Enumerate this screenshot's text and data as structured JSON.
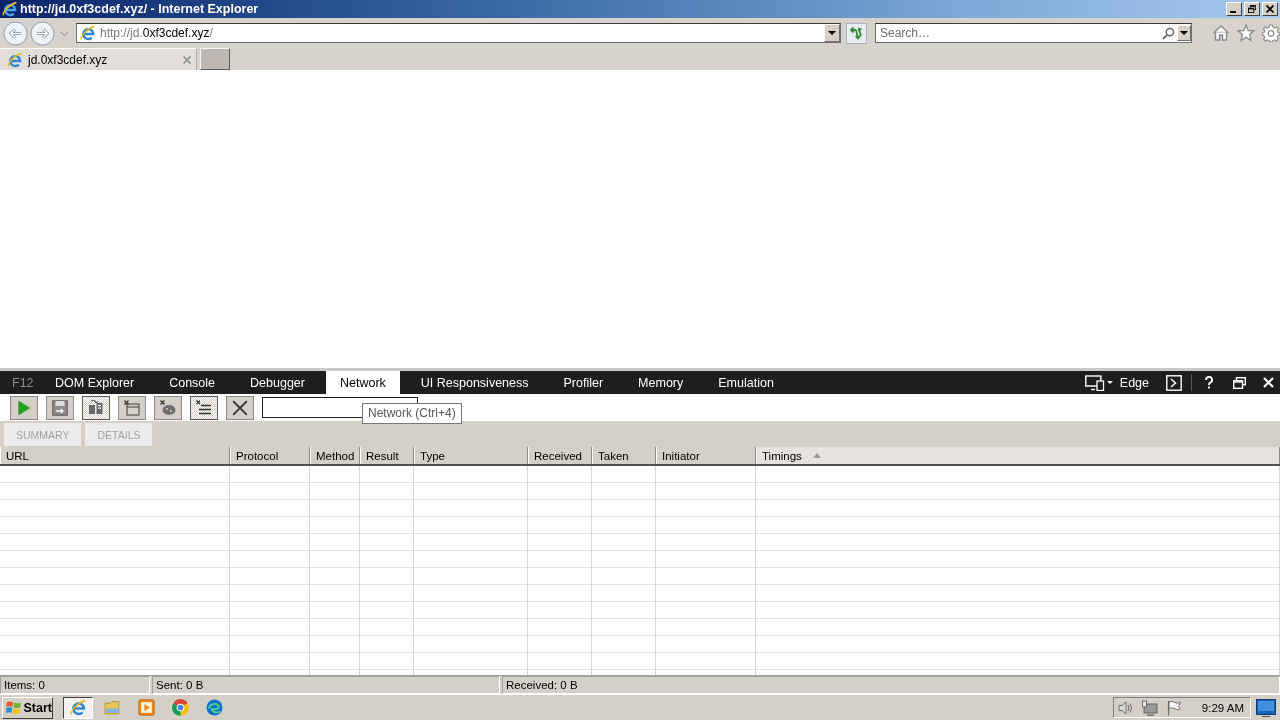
{
  "window": {
    "title": "http://jd.0xf3cdef.xyz/ - Internet Explorer"
  },
  "address_bar": {
    "url_prefix": "http://jd.",
    "url_domain": "0xf3cdef.xyz",
    "url_suffix": "/"
  },
  "search": {
    "placeholder": "Search…"
  },
  "browser_tabs": [
    {
      "label": "jd.0xf3cdef.xyz",
      "selected": true
    }
  ],
  "devtools": {
    "label": "F12",
    "tabs": [
      {
        "label": "DOM Explorer",
        "selected": false
      },
      {
        "label": "Console",
        "selected": false
      },
      {
        "label": "Debugger",
        "selected": false
      },
      {
        "label": "Network",
        "selected": true
      },
      {
        "label": "UI Responsiveness",
        "selected": false
      },
      {
        "label": "Profiler",
        "selected": false
      },
      {
        "label": "Memory",
        "selected": false
      },
      {
        "label": "Emulation",
        "selected": false
      }
    ],
    "document_mode": "Edge",
    "toolbar_buttons": [
      {
        "on": false
      },
      {
        "on": false
      },
      {
        "on": true
      },
      {
        "on": false
      },
      {
        "on": false
      },
      {
        "on": true
      },
      {
        "on": false
      }
    ],
    "tooltip": "Network (Ctrl+4)",
    "view_tabs": [
      {
        "label": "SUMMARY",
        "selected": false
      },
      {
        "label": "DETAILS",
        "selected": false
      }
    ],
    "table": {
      "columns": [
        {
          "label": "URL",
          "sorted": false
        },
        {
          "label": "Protocol",
          "sorted": false
        },
        {
          "label": "Method",
          "sorted": false
        },
        {
          "label": "Result",
          "sorted": false
        },
        {
          "label": "Type",
          "sorted": false
        },
        {
          "label": "Received",
          "sorted": false
        },
        {
          "label": "Taken",
          "sorted": false
        },
        {
          "label": "Initiator",
          "sorted": false
        },
        {
          "label": "Timings",
          "sorted": true
        }
      ]
    },
    "status_bar": [
      "Items: 0",
      "Sent: 0 B",
      "Received: 0 B"
    ]
  },
  "taskbar": {
    "start": "Start",
    "programs": [
      {
        "selected": true
      },
      {
        "selected": false
      },
      {
        "selected": false
      },
      {
        "selected": false
      },
      {
        "selected": false
      }
    ],
    "clock": "9:29 AM"
  }
}
